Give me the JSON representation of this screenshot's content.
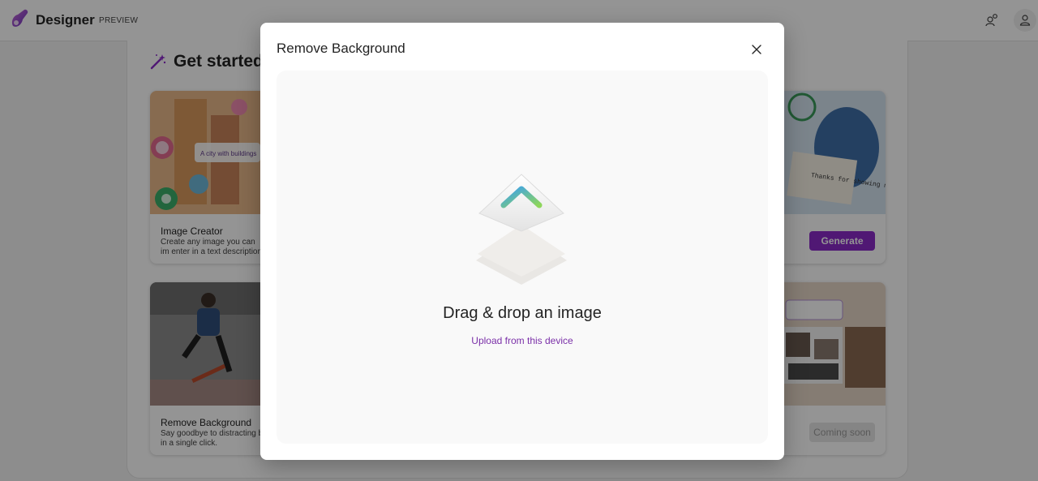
{
  "header": {
    "brand": "Designer",
    "badge": "PREVIEW",
    "share_icon": "people-share-icon",
    "user_icon": "person-icon"
  },
  "page": {
    "section_title": "Get started",
    "section_icon": "magic-wand-icon",
    "tiles": [
      {
        "title": "Image Creator",
        "description": "Create any image you can im enter in a text description.",
        "prompt_chip": "A city with buildings",
        "button": "Generate"
      },
      {
        "title": "Remove Background",
        "description": "Say goodbye to distracting b in a single click.",
        "button": "Coming soon"
      }
    ],
    "right_card_note": "Thanks for showing me the world."
  },
  "modal": {
    "title": "Remove Background",
    "close_icon": "close-icon",
    "upload_icon": "upload-arrow-icon",
    "drag_text": "Drag & drop an image",
    "upload_link": "Upload from this device"
  },
  "colors": {
    "accent": "#8a2ac9",
    "link": "#7a2fa8",
    "overlay": "rgba(0,0,0,0.42)"
  }
}
